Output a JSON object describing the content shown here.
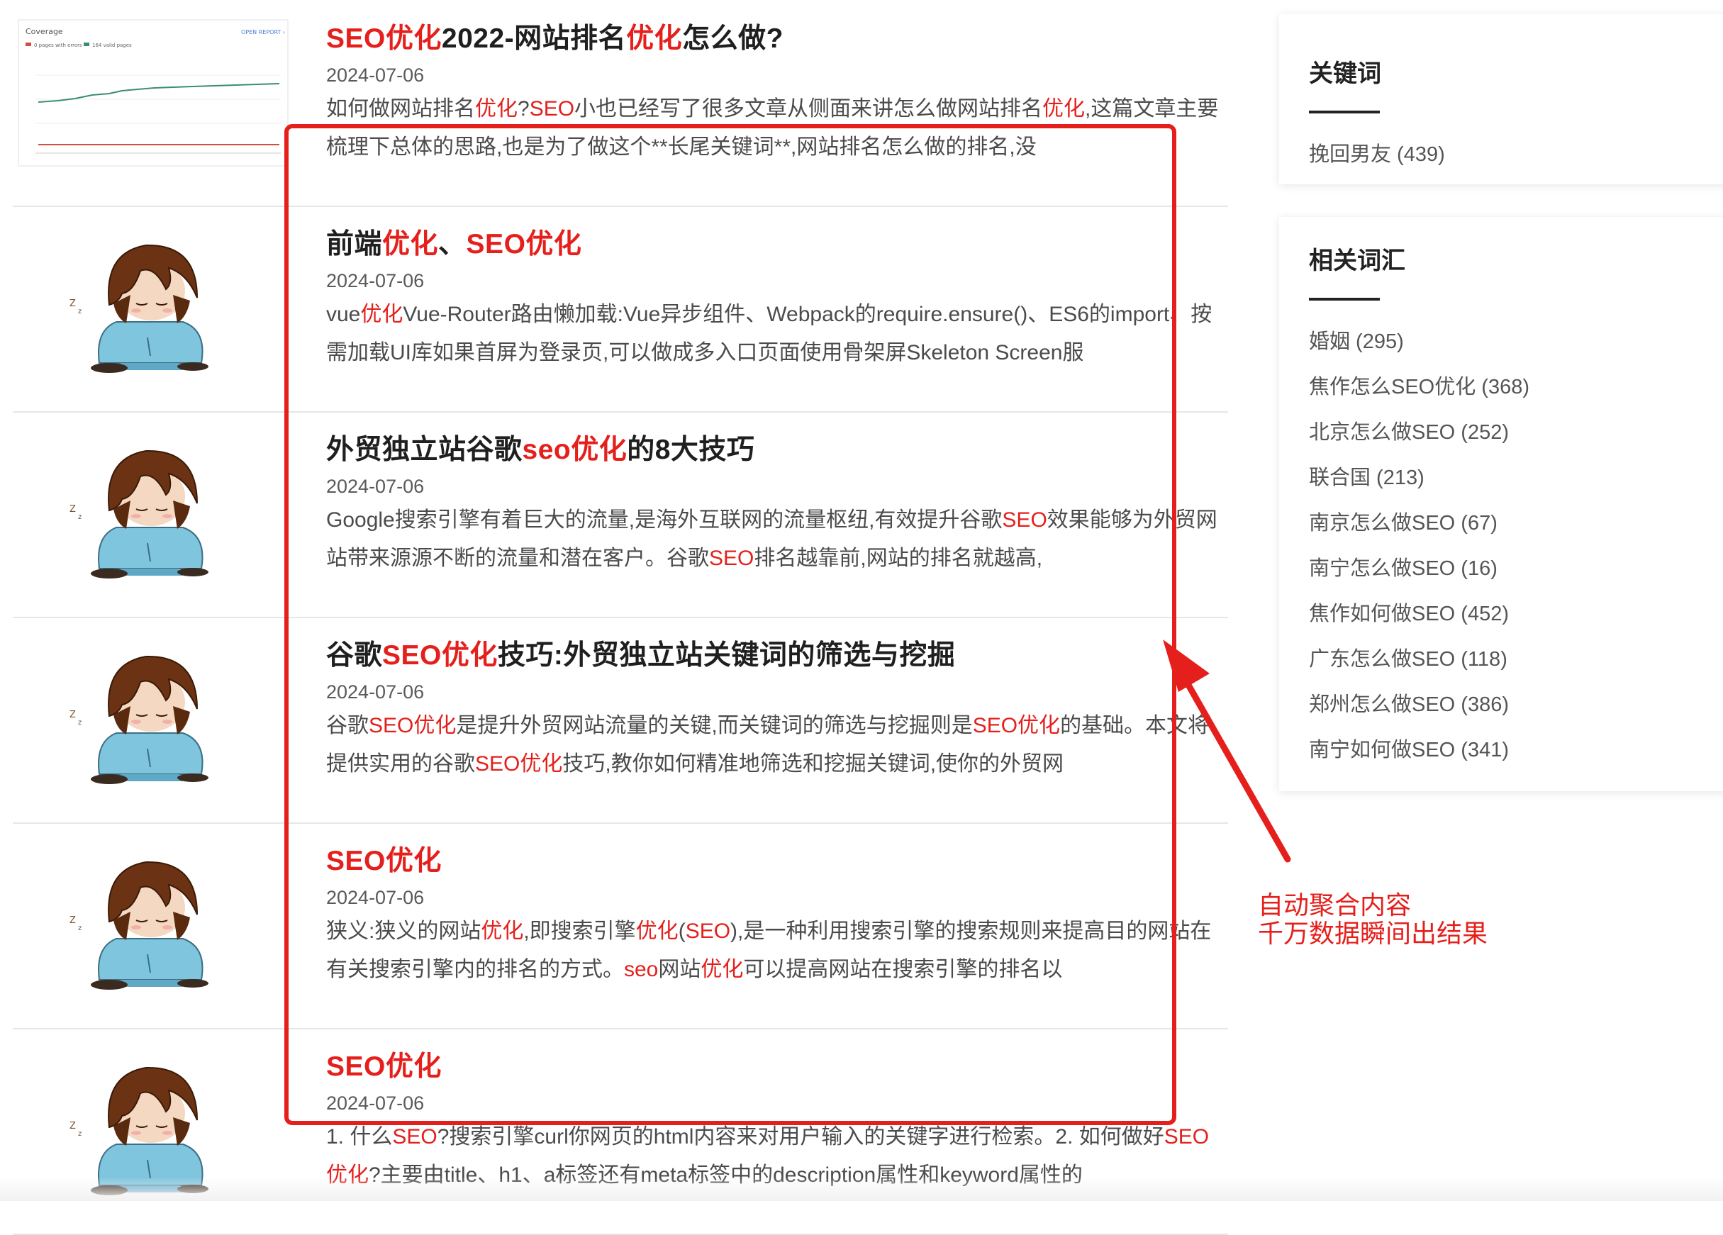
{
  "articles": [
    {
      "title": [
        {
          "t": "SEO优化",
          "h": true
        },
        {
          "t": "2022-网站排名",
          "h": false
        },
        {
          "t": "优化",
          "h": true
        },
        {
          "t": "怎么做?",
          "h": false
        }
      ],
      "date": "2024-07-06",
      "excerpt": [
        {
          "t": "如何做网站排名",
          "h": false
        },
        {
          "t": "优化",
          "h": true
        },
        {
          "t": "?",
          "h": false
        },
        {
          "t": "SEO",
          "h": true
        },
        {
          "t": "小也已经写了很多文章从侧面来讲怎么做网站排名",
          "h": false
        },
        {
          "t": "优化",
          "h": true
        },
        {
          "t": ",这篇文章主要梳理下总体的思路,也是为了做这个**长尾关键词**,网站排名怎么做的排名,没",
          "h": false
        }
      ],
      "thumb": "coverage-chart",
      "thumb_text": {
        "title": "Coverage",
        "link": "OPEN REPORT",
        "legend_errors": "0 pages with errors",
        "legend_valid": "164 valid pages"
      }
    },
    {
      "title": [
        {
          "t": "前端",
          "h": false
        },
        {
          "t": "优化",
          "h": true
        },
        {
          "t": "、",
          "h": false
        },
        {
          "t": "SEO优化",
          "h": true
        }
      ],
      "date": "2024-07-06",
      "excerpt": [
        {
          "t": "vue",
          "h": false
        },
        {
          "t": "优化",
          "h": true
        },
        {
          "t": "Vue-Router路由懒加载:Vue异步组件、Webpack的require.ensure()、ES6的import、按需加载UI库如果首屏为登录页,可以做成多入口页面使用骨架屏Skeleton Screen服",
          "h": false
        }
      ],
      "thumb": "anime-character"
    },
    {
      "title": [
        {
          "t": "外贸独立站谷歌",
          "h": false
        },
        {
          "t": "seo优化",
          "h": true
        },
        {
          "t": "的8大技巧",
          "h": false
        }
      ],
      "date": "2024-07-06",
      "excerpt": [
        {
          "t": "Google搜索引擎有着巨大的流量,是海外互联网的流量枢纽,有效提升谷歌",
          "h": false
        },
        {
          "t": "SEO",
          "h": true
        },
        {
          "t": "效果能够为外贸网站带来源源不断的流量和潜在客户。谷歌",
          "h": false
        },
        {
          "t": "SEO",
          "h": true
        },
        {
          "t": "排名越靠前,网站的排名就越高,",
          "h": false
        }
      ],
      "thumb": "anime-character"
    },
    {
      "title": [
        {
          "t": "谷歌",
          "h": false
        },
        {
          "t": "SEO优化",
          "h": true
        },
        {
          "t": "技巧:外贸独立站关键词的筛选与挖掘",
          "h": false
        }
      ],
      "date": "2024-07-06",
      "excerpt": [
        {
          "t": "谷歌",
          "h": false
        },
        {
          "t": "SEO优化",
          "h": true
        },
        {
          "t": "是提升外贸网站流量的关键,而关键词的筛选与挖掘则是",
          "h": false
        },
        {
          "t": "SEO优化",
          "h": true
        },
        {
          "t": "的基础。本文将提供实用的谷歌",
          "h": false
        },
        {
          "t": "SEO优化",
          "h": true
        },
        {
          "t": "技巧,教你如何精准地筛选和挖掘关键词,使你的外贸网",
          "h": false
        }
      ],
      "thumb": "anime-character"
    },
    {
      "title": [
        {
          "t": "SEO优化",
          "h": true
        }
      ],
      "date": "2024-07-06",
      "excerpt": [
        {
          "t": "狭义:狭义的网站",
          "h": false
        },
        {
          "t": "优化",
          "h": true
        },
        {
          "t": ",即搜索引擎",
          "h": false
        },
        {
          "t": "优化",
          "h": true
        },
        {
          "t": "(",
          "h": false
        },
        {
          "t": "SEO",
          "h": true
        },
        {
          "t": "),是一种利用搜索引擎的搜索规则来提高目的网站在有关搜索引擎内的排名的方式。",
          "h": false
        },
        {
          "t": "seo",
          "h": true
        },
        {
          "t": "网站",
          "h": false
        },
        {
          "t": "优化",
          "h": true
        },
        {
          "t": "可以提高网站在搜索引擎的排名以",
          "h": false
        }
      ],
      "thumb": "anime-character"
    },
    {
      "title": [
        {
          "t": "SEO优化",
          "h": true
        }
      ],
      "date": "2024-07-06",
      "excerpt": [
        {
          "t": "1. 什么",
          "h": false
        },
        {
          "t": "SEO",
          "h": true
        },
        {
          "t": "?搜索引擎curl你网页的html内容来对用户输入的关键字进行检索。2. 如何做好",
          "h": false
        },
        {
          "t": "SEO优化",
          "h": true
        },
        {
          "t": "?主要由title、h1、a标签还有meta标签中的description属性和keyword属性的",
          "h": false
        }
      ],
      "thumb": "anime-character"
    }
  ],
  "sidebar": {
    "keywords": {
      "heading": "关键词",
      "items": [
        "挽回男友 (439)"
      ]
    },
    "related": {
      "heading": "相关词汇",
      "items": [
        "婚姻 (295)",
        "焦作怎么SEO优化 (368)",
        "北京怎么做SEO (252)",
        "联合国 (213)",
        "南京怎么做SEO (67)",
        "南宁怎么做SEO (16)",
        "焦作如何做SEO (452)",
        "广东怎么做SEO (118)",
        "郑州怎么做SEO (386)",
        "南宁如何做SEO (341)"
      ]
    }
  },
  "annotation": {
    "lines": [
      "自动聚合内容",
      "千万数据瞬间出结果"
    ],
    "color": "#e5201c"
  },
  "colors": {
    "highlight": "#e5201c",
    "title": "#1f1f1f",
    "text": "#4b4b4b",
    "divider": "#e6e6e6"
  }
}
